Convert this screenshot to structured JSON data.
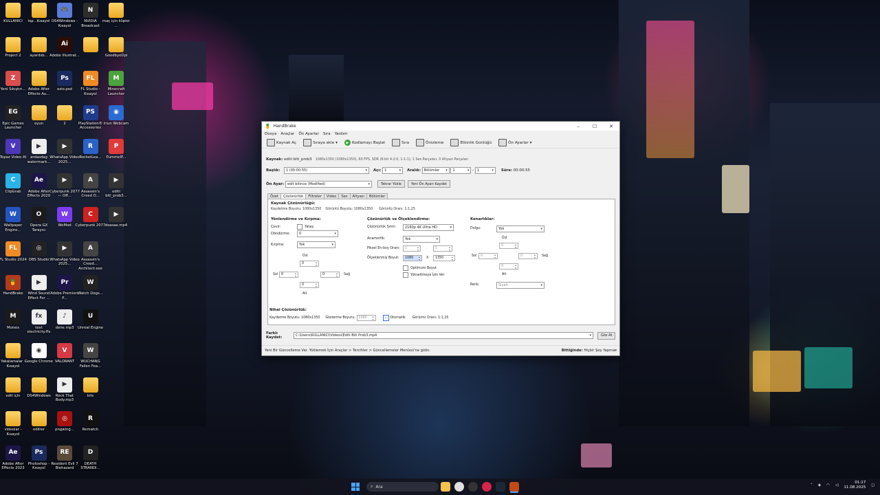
{
  "desktop": {
    "icons": [
      {
        "label": "KULLANICI",
        "col": 0,
        "row": 0,
        "kind": "folder"
      },
      {
        "label": "tsp...Kısayol",
        "col": 1,
        "row": 0,
        "kind": "folder"
      },
      {
        "label": "DS4Windows - Kısayol",
        "col": 2,
        "row": 0,
        "kind": "app",
        "color": "#5a7bd8",
        "glyph": "🎮"
      },
      {
        "label": "NVIDIA Broadcast",
        "col": 3,
        "row": 0,
        "kind": "app",
        "color": "#2d2d2d",
        "glyph": "N"
      },
      {
        "label": "maç için klipler ...",
        "col": 4,
        "row": 0,
        "kind": "folder"
      },
      {
        "label": "Project 2",
        "col": 0,
        "row": 1,
        "kind": "folder"
      },
      {
        "label": "ayardsb...",
        "col": 1,
        "row": 1,
        "kind": "folder"
      },
      {
        "label": "Adobe Illustrat...",
        "col": 2,
        "row": 1,
        "kind": "app",
        "color": "#2b0c04",
        "glyph": "Ai"
      },
      {
        "label": "",
        "col": 3,
        "row": 1,
        "kind": "folder"
      },
      {
        "label": "GoodbyeDpi",
        "col": 4,
        "row": 1,
        "kind": "folder"
      },
      {
        "label": "Yeni Sıkıştırı...",
        "col": 0,
        "row": 2,
        "kind": "app",
        "color": "#d94d4d",
        "glyph": "Z"
      },
      {
        "label": "Adobe After Effects Au...",
        "col": 1,
        "row": 2,
        "kind": "folder"
      },
      {
        "label": "ezio.psd",
        "col": 2,
        "row": 2,
        "kind": "app",
        "color": "#1b2a5e",
        "glyph": "Ps"
      },
      {
        "label": "FL Studio - Kısayol",
        "col": 3,
        "row": 2,
        "kind": "app",
        "color": "#f08a24",
        "glyph": "FL"
      },
      {
        "label": "Minecraft Launcher",
        "col": 4,
        "row": 2,
        "kind": "app",
        "color": "#4aa33c",
        "glyph": "M"
      },
      {
        "label": "Epic Games Launcher",
        "col": 0,
        "row": 3,
        "kind": "app",
        "color": "#222",
        "glyph": "EG"
      },
      {
        "label": "oyun",
        "col": 1,
        "row": 3,
        "kind": "folder"
      },
      {
        "label": "2",
        "col": 2,
        "row": 3,
        "kind": "folder"
      },
      {
        "label": "PlayStation® Accessories",
        "col": 3,
        "row": 3,
        "kind": "app",
        "color": "#1f3b8c",
        "glyph": "PS"
      },
      {
        "label": "Iriun Webcam",
        "col": 4,
        "row": 3,
        "kind": "app",
        "color": "#2a6bd1",
        "glyph": "◉"
      },
      {
        "label": "Topaz Video AI",
        "col": 0,
        "row": 4,
        "kind": "app",
        "color": "#4c38b8",
        "glyph": "V"
      },
      {
        "label": "ardasdag watermark...",
        "col": 1,
        "row": 4,
        "kind": "app",
        "color": "#eee",
        "glyph": "▶"
      },
      {
        "label": "WhatsApp Video 2025...",
        "col": 2,
        "row": 4,
        "kind": "app",
        "color": "#333",
        "glyph": "▶"
      },
      {
        "label": "RocketLea...",
        "col": 3,
        "row": 4,
        "kind": "app",
        "color": "#2b62c7",
        "glyph": "R"
      },
      {
        "label": "PummelP...",
        "col": 4,
        "row": 4,
        "kind": "app",
        "color": "#e03a3a",
        "glyph": "P"
      },
      {
        "label": "ClipGrab",
        "col": 0,
        "row": 5,
        "kind": "app",
        "color": "#2ab3e8",
        "glyph": "C"
      },
      {
        "label": "Adobe After Effects 2020",
        "col": 1,
        "row": 5,
        "kind": "app",
        "color": "#1d1547",
        "glyph": "Ae"
      },
      {
        "label": "Cyberpunk 2077 — Off...",
        "col": 2,
        "row": 5,
        "kind": "app",
        "color": "#333",
        "glyph": "▶"
      },
      {
        "label": "Assassin's Creed O...",
        "col": 3,
        "row": 5,
        "kind": "app",
        "color": "#444",
        "glyph": "A"
      },
      {
        "label": "editi biti_prob3...",
        "col": 4,
        "row": 5,
        "kind": "app",
        "color": "#333",
        "glyph": "▶"
      },
      {
        "label": "Wallpaper Engine...",
        "col": 0,
        "row": 6,
        "kind": "app",
        "color": "#2454c2",
        "glyph": "W"
      },
      {
        "label": "Opera GX Tarayıcı",
        "col": 1,
        "row": 6,
        "kind": "app",
        "color": "#1b1b1b",
        "glyph": "O"
      },
      {
        "label": "WeMod",
        "col": 2,
        "row": 6,
        "kind": "app",
        "color": "#7b3cf0",
        "glyph": "W"
      },
      {
        "label": "Cyberpunk 2077",
        "col": 3,
        "row": 6,
        "kind": "app",
        "color": "#c22",
        "glyph": "C"
      },
      {
        "label": "dsasaa.mp4",
        "col": 4,
        "row": 6,
        "kind": "app",
        "color": "#333",
        "glyph": "▶"
      },
      {
        "label": "FL Studio 2024",
        "col": 0,
        "row": 7,
        "kind": "app",
        "color": "#f08a24",
        "glyph": "FL"
      },
      {
        "label": "OBS Studio",
        "col": 1,
        "row": 7,
        "kind": "app",
        "color": "#222",
        "glyph": "◎"
      },
      {
        "label": "WhatsApp Video 2025...",
        "col": 2,
        "row": 7,
        "kind": "app",
        "color": "#333",
        "glyph": "▶"
      },
      {
        "label": "Assassin's Creed... Architect.exe",
        "col": 3,
        "row": 7,
        "kind": "app",
        "color": "#444",
        "glyph": "A"
      },
      {
        "label": "HandBrake",
        "col": 0,
        "row": 8,
        "kind": "app",
        "color": "#b23b1c",
        "glyph": "🍍"
      },
      {
        "label": "Wind Sound Effect For ...",
        "col": 1,
        "row": 8,
        "kind": "app",
        "color": "#eee",
        "glyph": "▶"
      },
      {
        "label": "Adobe Premiere P...",
        "col": 2,
        "row": 8,
        "kind": "app",
        "color": "#1d1547",
        "glyph": "Pr"
      },
      {
        "label": "Watch Dogs...",
        "col": 3,
        "row": 8,
        "kind": "app",
        "color": "#222",
        "glyph": "W"
      },
      {
        "label": "Moises",
        "col": 0,
        "row": 9,
        "kind": "app",
        "color": "#1b1b1b",
        "glyph": "M"
      },
      {
        "label": "text electricity.ffx",
        "col": 1,
        "row": 9,
        "kind": "app",
        "color": "#eee",
        "glyph": "fx"
      },
      {
        "label": "dene.mp3",
        "col": 2,
        "row": 9,
        "kind": "app",
        "color": "#eee",
        "glyph": "♪"
      },
      {
        "label": "Unreal Engine",
        "col": 3,
        "row": 9,
        "kind": "app",
        "color": "#111",
        "glyph": "U"
      },
      {
        "label": "Yakalamalar - Kısayol",
        "col": 0,
        "row": 10,
        "kind": "folder"
      },
      {
        "label": "Google Chrome",
        "col": 1,
        "row": 10,
        "kind": "app",
        "color": "#fff",
        "glyph": "◉"
      },
      {
        "label": "VALORANT",
        "col": 2,
        "row": 10,
        "kind": "app",
        "color": "#d53a45",
        "glyph": "V"
      },
      {
        "label": "WUCHANG Fallen Fea...",
        "col": 3,
        "row": 10,
        "kind": "app",
        "color": "#444",
        "glyph": "W"
      },
      {
        "label": "edit için",
        "col": 0,
        "row": 11,
        "kind": "folder"
      },
      {
        "label": "DS4Windows",
        "col": 1,
        "row": 11,
        "kind": "folder"
      },
      {
        "label": "Rock That Body.mp3",
        "col": 2,
        "row": 11,
        "kind": "app",
        "color": "#eee",
        "glyph": "▶"
      },
      {
        "label": "kits",
        "col": 3,
        "row": 11,
        "kind": "folder"
      },
      {
        "label": "videolar - Kısayol",
        "col": 0,
        "row": 12,
        "kind": "folder"
      },
      {
        "label": "editler",
        "col": 1,
        "row": 12,
        "kind": "folder"
      },
      {
        "label": "pngwing...",
        "col": 2,
        "row": 12,
        "kind": "app",
        "color": "#a11",
        "glyph": "◎"
      },
      {
        "label": "Rematch",
        "col": 3,
        "row": 12,
        "kind": "app",
        "color": "#111",
        "glyph": "R"
      },
      {
        "label": "Adobe After Effects 2023",
        "col": 0,
        "row": 13,
        "kind": "app",
        "color": "#1d1547",
        "glyph": "Ae"
      },
      {
        "label": "Photoshop - Kısayol",
        "col": 1,
        "row": 13,
        "kind": "app",
        "color": "#1b2a5e",
        "glyph": "Ps"
      },
      {
        "label": "Resident Evil 7 Biohazard",
        "col": 2,
        "row": 13,
        "kind": "app",
        "color": "#5a4a3a",
        "glyph": "RE"
      },
      {
        "label": "DEATH STRANDI...",
        "col": 3,
        "row": 13,
        "kind": "app",
        "color": "#222",
        "glyph": "D"
      }
    ]
  },
  "window": {
    "title": "HandBrake",
    "menu": [
      "Dosya",
      "Araçlar",
      "Ön Ayarlar",
      "Sıra",
      "Yardım"
    ],
    "toolbar": {
      "source": "Kaynak Aç",
      "add_queue": "Sıraya ekle",
      "start": "Kodlamayı Başlat",
      "queue": "Sıra",
      "preview": "Önizleme",
      "activity": "Etkinlik Günlüğü",
      "presets": "Ön Ayarlar"
    },
    "source": {
      "label": "Kaynak:",
      "name": "editi biti_prob3",
      "info": "1080x1350 (1080x1350), 60 FPS, SDR (8-bit 4:2:0, 1-1-1), 1 Ses Parçaları, 0 Altyazı Parçaları"
    },
    "title_row": {
      "label": "Başlık:",
      "value": "1 (00:00:55)",
      "angle_label": "Açı:",
      "angle": "1",
      "range_label": "Aralık:",
      "range_mode": "Bölümler",
      "range_from": "1",
      "range_dash": "-",
      "range_to": "1",
      "duration_label": "Süre:",
      "duration": "00:00:55"
    },
    "preset_row": {
      "label": "Ön Ayar:",
      "value": "edit bitince (Modified)",
      "reload": "Tekrar Yükle",
      "save_new": "Yeni Ön Ayarı Kaydet"
    },
    "tabs": [
      "Özet",
      "Çözünürlük",
      "Filtreler",
      "Video",
      "Ses",
      "Altyazı",
      "Bölümler"
    ],
    "active_tab": "Çözünürlük",
    "dimensions": {
      "source_heading": "Kaynak Çözünürlüğü:",
      "storage_label": "Kaydetme Boyutu:",
      "storage": "1080x1350",
      "display_label": "Görüntü Boyutu:",
      "display": "1080x1350",
      "aspect_label": "Görüntü Oranı:",
      "aspect": "1:1,25",
      "orientation_heading": "Yönlendirme ve Kırpma:",
      "flip_label": "Çevir:",
      "flip_value": "Yatay",
      "rotate_label": "Döndürme:",
      "rotate_value": "0",
      "crop_label": "Kırpma:",
      "crop_value": "Yok",
      "top_label": "Üst",
      "top": "0",
      "left_label": "Sol",
      "left": "0",
      "right": "0",
      "right_label": "Sağ",
      "bottom": "0",
      "bottom_label": "Alt",
      "resolution_heading": "Çözünürlük ve Ölçeklendirme:",
      "limit_label": "Çözünürlük Sınırı:",
      "limit_value": "2160p 4K Ultra HD",
      "anamorphic_label": "Anamorfik:",
      "anamorphic_value": "Yok",
      "pixel_aspect_label": "Piksel En-boy Oranı:",
      "pixel_aspect_a": "1",
      "pixel_aspect_sep": ":",
      "pixel_aspect_b": "1",
      "scaled_label": "Ölçeklenmiş Boyut:",
      "scaled_w": "1080",
      "scaled_x": "X",
      "scaled_h": "1350",
      "optimal": "Optimum Boyut",
      "upscale": "Yükseltmeye İzin Ver",
      "borders_heading": "Kenarlıklar:",
      "fill_label": "Dolgu:",
      "fill_value": "Yok",
      "b_top_label": "Üst",
      "b_top": "0",
      "b_left_label": "Sol",
      "b_left": "0",
      "b_right": "0",
      "b_right_label": "Sağ",
      "b_bottom": "0",
      "b_bottom_label": "Alt",
      "color_label": "Renk:",
      "color_value": "Siyah",
      "final_heading": "Nihai Çözünürlük:",
      "final_storage_label": "Kaydetme Boyutu:",
      "final_storage": "1080x1350",
      "final_display_label": "Gösterme Boyutu:",
      "final_display": "1080",
      "auto_label": "Otomatik",
      "final_aspect_label": "Görüntü Oranı:",
      "final_aspect": "1:1,25"
    },
    "save_row": {
      "label": "Farklı Kaydet:",
      "path": "C:\\Users\\KULLANICI\\Videos\\Editi Biti Prob3.mp4",
      "browse": "Göz At"
    },
    "status": {
      "message": "Yeni Bir Güncelleme Var. Yüklemek İçin Araçlar > Tercihler > Güncellemeler Menüsü'ne gidin.",
      "when_done_label": "Bittiğinde:",
      "when_done_value": "Hiçbir Şey Yapma"
    }
  },
  "taskbar": {
    "search": "Ara",
    "time": "01:17",
    "date": "11.08.2025"
  }
}
